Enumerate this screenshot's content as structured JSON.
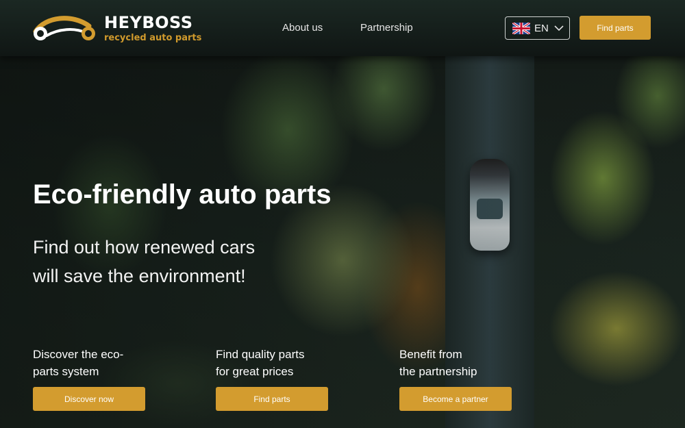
{
  "header": {
    "brand_title": "HEYBOSS",
    "brand_subtitle": "recycled auto parts",
    "nav": [
      {
        "label": "About us"
      },
      {
        "label": "Partnership"
      }
    ],
    "language": {
      "label": "EN",
      "flag": "uk-flag-icon"
    },
    "cta_label": "Find parts"
  },
  "hero": {
    "title": "Eco-friendly auto parts",
    "subtitle_line1": "Find out how renewed cars",
    "subtitle_line2": "will save the environment!"
  },
  "cards": [
    {
      "text_line1": "Discover the eco-",
      "text_line2": "parts system",
      "button": "Discover now"
    },
    {
      "text_line1": "Find quality parts",
      "text_line2": "for great prices",
      "button": "Find parts"
    },
    {
      "text_line1": "Benefit from",
      "text_line2": "the partnership",
      "button": "Become a partner"
    }
  ],
  "colors": {
    "accent": "#d39c2f",
    "header_bg": "#141c19"
  }
}
